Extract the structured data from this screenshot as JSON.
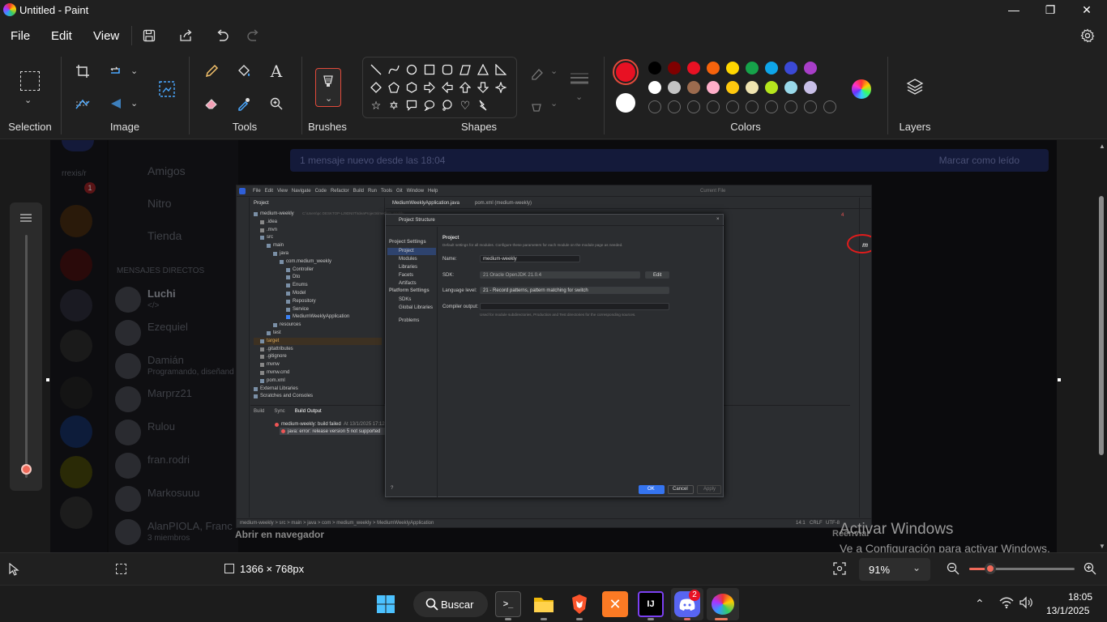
{
  "window": {
    "title": "Untitled - Paint",
    "minimize": "—",
    "maximize": "❐",
    "close": "✕"
  },
  "menu": {
    "file": "File",
    "edit": "Edit",
    "view": "View"
  },
  "ribbon": {
    "groups": {
      "selection": "Selection",
      "image": "Image",
      "tools": "Tools",
      "brushes": "Brushes",
      "shapes": "Shapes",
      "colors": "Colors",
      "layers": "Layers"
    },
    "primary_color": "#e81123",
    "secondary_color": "#ffffff",
    "palette_row1": [
      "#000000",
      "#7f0000",
      "#e81123",
      "#f7630c",
      "#ffd700",
      "#16a34a",
      "#0ea5e9",
      "#3b49d6",
      "#a83ec8"
    ],
    "palette_row2": [
      "#ffffff",
      "#c3c3c3",
      "#9c6b4e",
      "#ffaec9",
      "#ffc90e",
      "#efe4b0",
      "#b5e61d",
      "#99d9ea",
      "#c8bfe7"
    ]
  },
  "screenshot": {
    "discord": {
      "banner": "1 mensaje nuevo desde las 18:04",
      "banner_action": "Marcar como leído",
      "nav": [
        "Amigos",
        "Nitro",
        "Tienda"
      ],
      "dm_header": "MENSAJES DIRECTOS",
      "dms": [
        {
          "name": "Luchi",
          "sub": "</>"
        },
        {
          "name": "Ezequiel",
          "sub": ""
        },
        {
          "name": "Damián",
          "sub": "Programando, diseñand"
        },
        {
          "name": "Marprz21",
          "sub": ""
        },
        {
          "name": "Rulou",
          "sub": ""
        },
        {
          "name": "fran.rodri",
          "sub": ""
        },
        {
          "name": "Markosuuu",
          "sub": ""
        },
        {
          "name": "AlanPIOLA, Franc",
          "sub": "3 miembros"
        }
      ],
      "bottom_left": "Abrir en navegador",
      "bottom_right": "Reenviar",
      "rail_badge": "1"
    },
    "intellij": {
      "menu": [
        "File",
        "Edit",
        "View",
        "Navigate",
        "Code",
        "Refactor",
        "Build",
        "Run",
        "Tools",
        "Git",
        "Window",
        "Help"
      ],
      "current_file": "Current File",
      "project_label": "Project",
      "tabs": [
        "MediumWeeklyApplication.java",
        "pom.xml (medium-weekly)"
      ],
      "tree": [
        {
          "t": "medium-weekly",
          "d": 0,
          "hint": "C:\\Users\\pc DESKTOP-LJ9DN0T\\IdeaProjects\\medium-weekly"
        },
        {
          "t": ".idea",
          "d": 1
        },
        {
          "t": ".mvn",
          "d": 1
        },
        {
          "t": "src",
          "d": 1
        },
        {
          "t": "main",
          "d": 2
        },
        {
          "t": "java",
          "d": 3
        },
        {
          "t": "com.medium_weekly",
          "d": 4
        },
        {
          "t": "Controller",
          "d": 5
        },
        {
          "t": "Dto",
          "d": 5
        },
        {
          "t": "Enums",
          "d": 5
        },
        {
          "t": "Model",
          "d": 5
        },
        {
          "t": "Repository",
          "d": 5
        },
        {
          "t": "Service",
          "d": 5
        },
        {
          "t": "MediumWeeklyApplication",
          "d": 5
        },
        {
          "t": "resources",
          "d": 3
        },
        {
          "t": "test",
          "d": 2
        },
        {
          "t": "target",
          "d": 1
        },
        {
          "t": ".gitattributes",
          "d": 1
        },
        {
          "t": ".gitignore",
          "d": 1
        },
        {
          "t": "mvnw",
          "d": 1
        },
        {
          "t": "mvnw.cmd",
          "d": 1
        },
        {
          "t": "pom.xml",
          "d": 1
        },
        {
          "t": "External Libraries",
          "d": 0
        },
        {
          "t": "Scratches and Consoles",
          "d": 0
        }
      ],
      "build_tabs": [
        "Build",
        "Sync",
        "Build Output"
      ],
      "build_line1": "medium-weekly: build failed",
      "build_line1_time": "At 13/1/2025 17:12 ami",
      "build_line2": "java: error: release version 5 not supported",
      "breadcrumb": "medium-weekly > src > main > java > com > medium_weekly > MediumWeeklyApplication",
      "status_right": [
        "14:1",
        "CRLF",
        "UTF-8"
      ],
      "errors": "4"
    },
    "dialog": {
      "title": "Project Structure",
      "left_sections": [
        {
          "header": "Project Settings",
          "items": [
            "Project",
            "Modules",
            "Libraries",
            "Facets",
            "Artifacts"
          ]
        },
        {
          "header": "Platform Settings",
          "items": [
            "SDKs",
            "Global Libraries"
          ]
        },
        {
          "header": "",
          "items": [
            "Problems"
          ]
        }
      ],
      "heading": "Project",
      "desc": "Default settings for all modules. Configure these parameters for each module on the module page as needed.",
      "name_label": "Name:",
      "name_value": "medium-weekly",
      "sdk_label": "SDK:",
      "sdk_value": "21 Oracle OpenJDK 21.0.4",
      "sdk_edit": "Edit",
      "lang_label": "Language level:",
      "lang_value": "21 - Record patterns, pattern matching for switch",
      "out_label": "Compiler output:",
      "out_hint": "Used for module subdirectories, Production and Test directories for the corresponding sources.",
      "ok": "OK",
      "cancel": "Cancel",
      "apply": "Apply",
      "help": "?"
    },
    "watermark_line1": "Activar Windows",
    "watermark_line2": "Ve a Configuración para activar Windows."
  },
  "statusbar": {
    "size": "1366 × 768px",
    "zoom": "91%",
    "zoom_level": 0.2
  },
  "taskbar": {
    "search": "Buscar",
    "time": "18:05",
    "date": "13/1/2025",
    "discord_badge": "2"
  }
}
